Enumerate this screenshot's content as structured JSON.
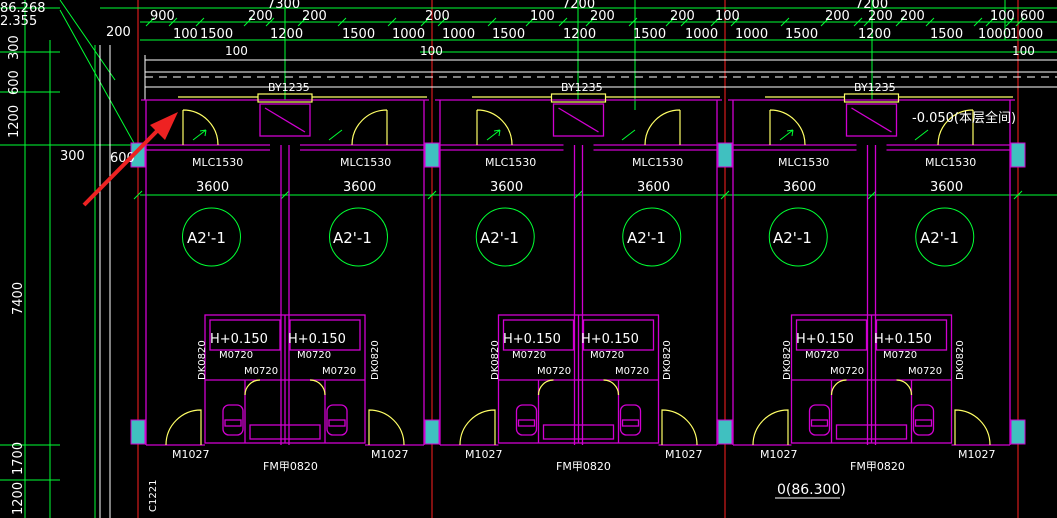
{
  "palette": {
    "background": "#000000",
    "dimension": "#00ff33",
    "wall": "#d000d0",
    "window": "#ffff66",
    "column": "#40c0c0",
    "grid_axis": "#ff2020",
    "annotation_arrow": "#ee2222"
  },
  "top_dims": {
    "row0": [
      "86.268",
      "7300",
      "7200",
      "7200"
    ],
    "row1": [
      "2.355",
      "900",
      "200",
      "200",
      "200",
      "100",
      "200",
      "200",
      "100",
      "200",
      "200",
      "200",
      "100",
      "600"
    ],
    "row2": [
      "100",
      "1500",
      "1200",
      "1500",
      "1000",
      "1000",
      "1500",
      "1200",
      "1500",
      "1000",
      "1000",
      "1500",
      "1200",
      "1500",
      "1000",
      "1000"
    ],
    "row3": [
      "100",
      "100",
      "100"
    ],
    "top_left": "200"
  },
  "left_dims": [
    "300",
    "600",
    "1200",
    "300",
    "600",
    "7400",
    "1700",
    "1200"
  ],
  "windows": {
    "by_labels": [
      "BY1235",
      "BY1235",
      "BY1235"
    ],
    "mlc_labels": [
      "MLC1530",
      "MLC1530",
      "MLC1530",
      "MLC1530",
      "MLC1530",
      "MLC1530"
    ]
  },
  "elevation_note": "-0.050(本层全间)",
  "bay_widths": [
    "3600",
    "3600",
    "3600",
    "3600",
    "3600",
    "3600"
  ],
  "room_tags": [
    "A2'-1",
    "A2'-1",
    "A2'-1",
    "A2'-1",
    "A2'-1",
    "A2'-1"
  ],
  "bathroom": {
    "h_labels": [
      "H+0.150",
      "H+0.150",
      "H+0.150",
      "H+0.150",
      "H+0.150",
      "H+0.150"
    ],
    "m0720_labels": [
      "M0720",
      "M0720",
      "M0720",
      "M0720",
      "M0720",
      "M0720",
      "M0720",
      "M0720",
      "M0720",
      "M0720",
      "M0720",
      "M0720"
    ],
    "dk_labels": [
      "DK0820",
      "DK0820",
      "DK0820",
      "DK0820",
      "DK0820",
      "DK0820"
    ],
    "fm_labels": [
      "FM甲0820",
      "FM甲0820",
      "FM甲0820"
    ]
  },
  "door_labels": [
    "M1027",
    "M1027",
    "M1027",
    "M1027",
    "M1027",
    "M1027"
  ],
  "bottom_labels": {
    "c_label": "C1221",
    "level": "0(86.300)"
  }
}
